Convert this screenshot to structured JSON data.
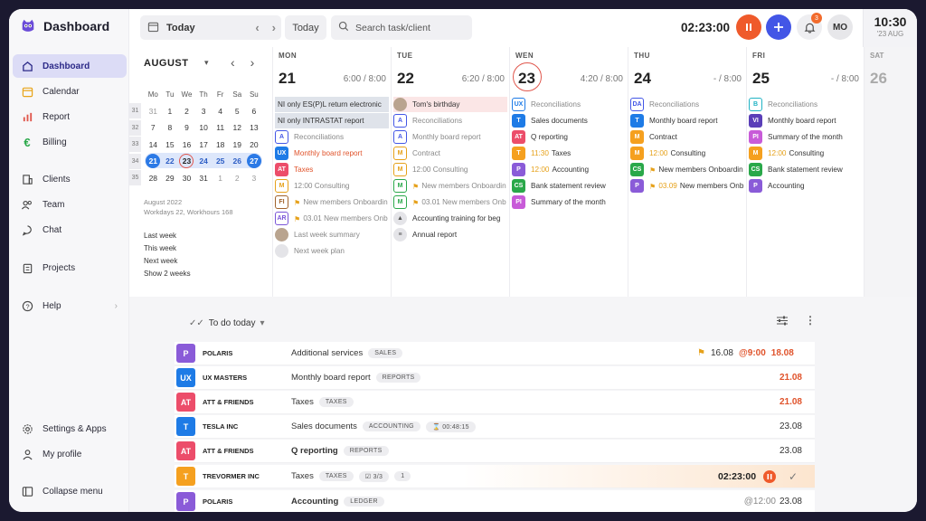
{
  "app": {
    "title": "Dashboard"
  },
  "colors": {
    "accent": "#4356e6",
    "active_nav": "#dcdcf6",
    "timer": "#ef5a2b"
  },
  "sidebar": {
    "items": [
      {
        "label": "Dashboard",
        "icon": "home-icon"
      },
      {
        "label": "Calendar",
        "icon": "calendar-icon"
      },
      {
        "label": "Report",
        "icon": "bar-chart-icon"
      },
      {
        "label": "Billing",
        "icon": "euro-icon"
      },
      {
        "label": "Clients",
        "icon": "building-icon"
      },
      {
        "label": "Team",
        "icon": "users-icon"
      },
      {
        "label": "Chat",
        "icon": "chat-icon"
      },
      {
        "label": "Projects",
        "icon": "clipboard-icon"
      },
      {
        "label": "Help",
        "icon": "help-icon"
      }
    ],
    "footer": [
      {
        "label": "Settings & Apps",
        "icon": "gear-icon"
      },
      {
        "label": "My profile",
        "icon": "user-icon"
      },
      {
        "label": "Collapse menu",
        "icon": "collapse-icon"
      }
    ]
  },
  "topbar": {
    "date_label": "Today",
    "today_button": "Today",
    "search_placeholder": "Search task/client",
    "timer": "02:23:00",
    "notification_count": "3",
    "avatar_initials": "MO",
    "clock_time": "10:30",
    "clock_date": "'23 AUG"
  },
  "minical": {
    "month": "AUGUST",
    "weekdays": [
      "Mo",
      "Tu",
      "We",
      "Th",
      "Fr",
      "Sa",
      "Su"
    ],
    "weeks": [
      {
        "num": "31",
        "days": [
          "31",
          "1",
          "2",
          "3",
          "4",
          "5",
          "6"
        ]
      },
      {
        "num": "32",
        "days": [
          "7",
          "8",
          "9",
          "10",
          "11",
          "12",
          "13"
        ]
      },
      {
        "num": "33",
        "days": [
          "14",
          "15",
          "16",
          "17",
          "18",
          "19",
          "20"
        ]
      },
      {
        "num": "34",
        "days": [
          "21",
          "22",
          "23",
          "24",
          "25",
          "26",
          "27"
        ]
      },
      {
        "num": "35",
        "days": [
          "28",
          "29",
          "30",
          "31",
          "1",
          "2",
          "3"
        ]
      }
    ],
    "info1": "August 2022",
    "info2": "Workdays 22, Workhours 168",
    "links": [
      "Last week",
      "This week",
      "Next week",
      "Show 2 weeks"
    ]
  },
  "week": {
    "days": [
      {
        "name": "MON",
        "date": "21",
        "hours": "6:00 / 8:00"
      },
      {
        "name": "TUE",
        "date": "22",
        "hours": "6:20 / 8:00"
      },
      {
        "name": "WEN",
        "date": "23",
        "hours": "4:20 / 8:00"
      },
      {
        "name": "THU",
        "date": "24",
        "hours": "- / 8:00"
      },
      {
        "name": "FRI",
        "date": "25",
        "hours": "- / 8:00"
      },
      {
        "name": "SAT",
        "date": "26",
        "hours": ""
      }
    ],
    "mon": [
      {
        "text": "NI only ES(P)L return electronic",
        "style": "hl"
      },
      {
        "text": "NI only INTRASTAT report",
        "style": "hl"
      },
      {
        "chip": "A",
        "text": "Reconciliations",
        "style": "muted"
      },
      {
        "chip": "UX",
        "text": "Monthly board report",
        "style": "orange"
      },
      {
        "chip": "AT",
        "text": "Taxes",
        "style": "orange"
      },
      {
        "chip": "M",
        "text": "12:00 Consulting",
        "style": "muted"
      },
      {
        "chip": "FI",
        "text": "New members Onboardin",
        "style": "muted",
        "flag": true
      },
      {
        "chip": "AR",
        "text": "03.01 New members Onb",
        "style": "muted",
        "flag": true
      },
      {
        "chip": "",
        "text": "Last week summary",
        "style": "muted"
      },
      {
        "chip": "",
        "text": "Next week plan",
        "style": "muted"
      }
    ],
    "tue": [
      {
        "chip": "",
        "text": "Tom's birthday",
        "style": "pink"
      },
      {
        "chip": "A",
        "text": "Reconciliations",
        "style": "muted"
      },
      {
        "chip": "A",
        "text": "Monthly board report",
        "style": "muted"
      },
      {
        "chip": "M",
        "text": "Contract",
        "style": "muted"
      },
      {
        "chip": "M",
        "text": "12:00 Consulting",
        "style": "muted"
      },
      {
        "chip": "M",
        "text": "New members Onboardin",
        "style": "muted",
        "flag": true
      },
      {
        "chip": "M",
        "text": "03.01 New members Onb",
        "style": "muted",
        "flag": true
      },
      {
        "chip": "",
        "text": "Accounting training for beg",
        "style": ""
      },
      {
        "chip": "",
        "text": "Annual report",
        "style": ""
      }
    ],
    "wen": [
      {
        "chip": "UX",
        "text": "Reconciliations",
        "style": "muted"
      },
      {
        "chip": "T",
        "text": "Sales documents",
        "style": ""
      },
      {
        "chip": "AT",
        "text": "Q reporting",
        "style": ""
      },
      {
        "chip": "T",
        "time": "11:30",
        "text": "Taxes",
        "style": ""
      },
      {
        "chip": "P",
        "time": "12:00",
        "text": "Accounting",
        "style": ""
      },
      {
        "chip": "CS",
        "text": "Bank statement review",
        "style": ""
      },
      {
        "chip": "PI",
        "text": "Summary of the month",
        "style": ""
      }
    ],
    "thu": [
      {
        "chip": "DA",
        "text": "Reconciliations",
        "style": "muted"
      },
      {
        "chip": "T",
        "text": "Monthly board report",
        "style": ""
      },
      {
        "chip": "M",
        "text": "Contract",
        "style": ""
      },
      {
        "chip": "M",
        "time": "12:00",
        "text": "Consulting",
        "style": ""
      },
      {
        "chip": "CS",
        "text": "New members Onboardin",
        "style": "",
        "flag": true
      },
      {
        "chip": "P",
        "time": "03.09",
        "text": "New members Onb",
        "style": "",
        "flag": true
      }
    ],
    "fri": [
      {
        "chip": "B",
        "text": "Reconciliations",
        "style": "muted"
      },
      {
        "chip": "VI",
        "text": "Monthly board report",
        "style": ""
      },
      {
        "chip": "PI",
        "text": "Summary of the month",
        "style": ""
      },
      {
        "chip": "M",
        "time": "12:00",
        "text": "Consulting",
        "style": ""
      },
      {
        "chip": "CS",
        "text": "Bank statement review",
        "style": ""
      },
      {
        "chip": "P",
        "text": "Accounting",
        "style": ""
      }
    ]
  },
  "todo": {
    "title": "To do today",
    "rows": [
      {
        "chip": "P",
        "client": "POLARIS",
        "task": "Additional services",
        "tag": "SALES",
        "flag_date": "16.08",
        "at": "@9:00",
        "date": "18.08",
        "date_style": "red"
      },
      {
        "chip": "UX",
        "client": "UX MASTERS",
        "task": "Monthly board report",
        "tag": "REPORTS",
        "date": "21.08",
        "date_style": "red"
      },
      {
        "chip": "AT",
        "client": "ATT & FRIENDS",
        "task": "Taxes",
        "tag": "TAXES",
        "date": "21.08",
        "date_style": "red"
      },
      {
        "chip": "T",
        "client": "TESLA INC",
        "task": "Sales documents",
        "tag": "ACCOUNTING",
        "timer": "00:48:15",
        "date": "23.08",
        "date_style": ""
      },
      {
        "chip": "AT",
        "client": "ATT & FRIENDS",
        "task": "Q reporting",
        "tag": "REPORTS",
        "date": "23.08",
        "date_style": "",
        "bold": true
      },
      {
        "chip": "T",
        "client": "TREVORMER INC",
        "task": "Taxes",
        "tag": "TAXES",
        "checks": "3/3",
        "count": "1",
        "timer": "02:23:00",
        "date": "",
        "date_style": "",
        "active": true
      },
      {
        "chip": "P",
        "client": "POLARIS",
        "task": "Accounting",
        "tag": "LEDGER",
        "at": "@12:00",
        "date": "23.08",
        "date_style": "",
        "bold": true
      }
    ]
  }
}
